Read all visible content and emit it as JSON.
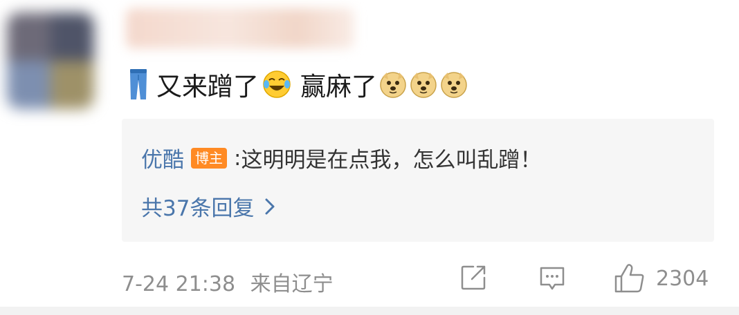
{
  "comment": {
    "text_part1": "又来蹭了",
    "text_part2": "赢麻了",
    "emojis": [
      "jeans-icon",
      "laugh-cry-icon",
      "doge-icon",
      "doge-icon",
      "doge-icon"
    ]
  },
  "reply": {
    "author": "优酷",
    "badge": "博主",
    "separator": ":",
    "text": "这明明是在点我，怎么叫乱蹭！",
    "more_replies": "共37条回复"
  },
  "footer": {
    "time": "7-24 21:38",
    "location": "来自辽宁",
    "like_count": "2304"
  },
  "colors": {
    "link_blue": "#4a76ab",
    "badge_orange": "#ff8a24",
    "meta_gray": "#8e8e8e",
    "reply_bg": "#f6f6f6"
  }
}
